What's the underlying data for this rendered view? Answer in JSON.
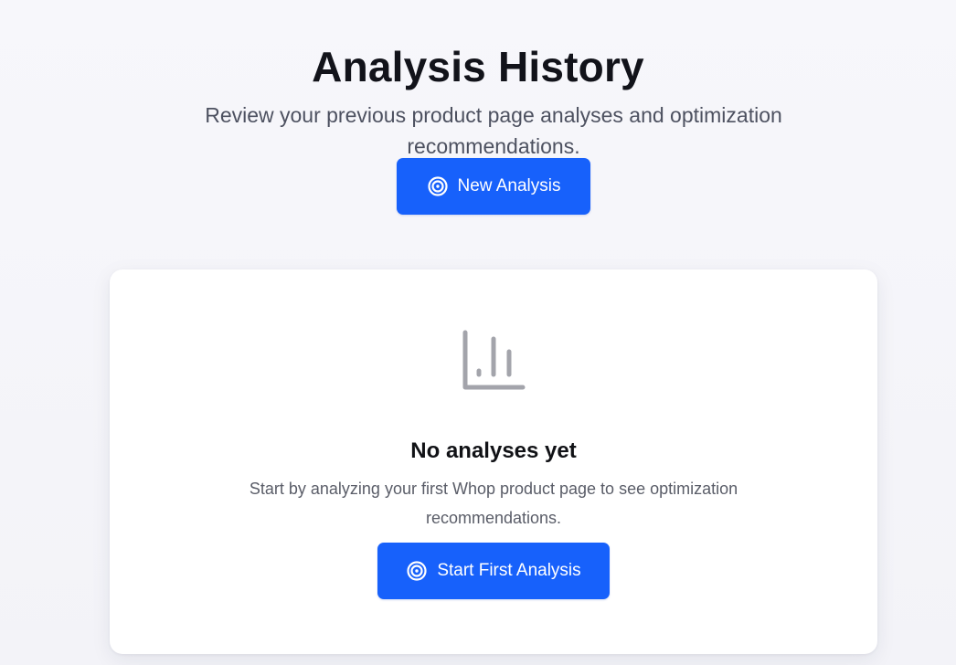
{
  "header": {
    "title": "Analysis History",
    "subtitle": "Review your previous product page analyses and optimization recommendations."
  },
  "actions": {
    "new_analysis_label": "New Analysis",
    "new_analysis_icon": "target-icon"
  },
  "empty_state": {
    "icon": "bar-chart-icon",
    "title": "No analyses yet",
    "description": "Start by analyzing your first Whop product page to see optimization recommendations.",
    "cta_label": "Start First Analysis",
    "cta_icon": "target-icon"
  },
  "colors": {
    "accent": "#1761fb",
    "background": "#f5f5f9",
    "card": "#ffffff",
    "muted_icon": "#a3a4ab",
    "heading": "#12131a",
    "body_text": "#5a5d68"
  }
}
